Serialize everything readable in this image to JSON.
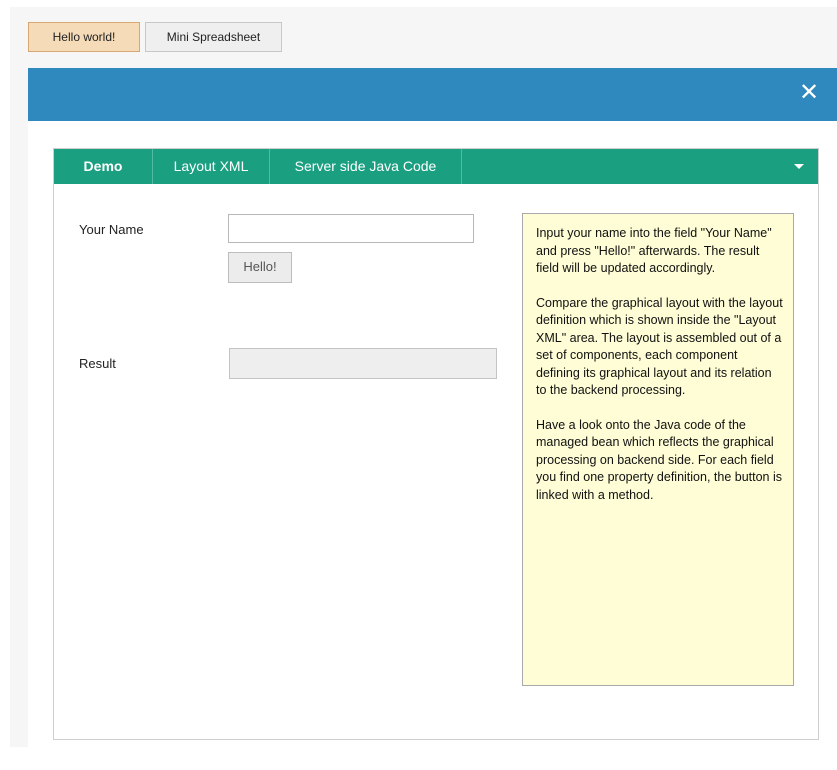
{
  "top_buttons": [
    {
      "label": "Hello world!",
      "active": true
    },
    {
      "label": "Mini Spreadsheet",
      "active": false
    }
  ],
  "window": {
    "close_symbol": "✕"
  },
  "tabs": [
    {
      "label": "Demo",
      "active": true
    },
    {
      "label": "Layout XML",
      "active": false
    },
    {
      "label": "Server side Java Code",
      "active": false
    }
  ],
  "form": {
    "name_label": "Your Name",
    "name_value": "",
    "hello_button": "Hello!",
    "result_label": "Result",
    "result_value": ""
  },
  "info": {
    "paragraphs": [
      "Input your name into the field \"Your Name\" and press \"Hello!\" afterwards. The result field will be updated accordingly.",
      "Compare the graphical layout with the layout definition which is shown inside the \"Layout XML\" area. The layout is assembled out of a set of components, each component defining its graphical layout and its relation to the backend processing.",
      "Have a look onto the Java code of the managed bean which reflects the graphical processing on backend side. For each field you find one property definition, the  button is linked with a method."
    ]
  },
  "colors": {
    "header_blue": "#2f88be",
    "tab_green": "#1aa081",
    "info_background": "#fefdd6",
    "active_button": "#f5dbb8"
  }
}
